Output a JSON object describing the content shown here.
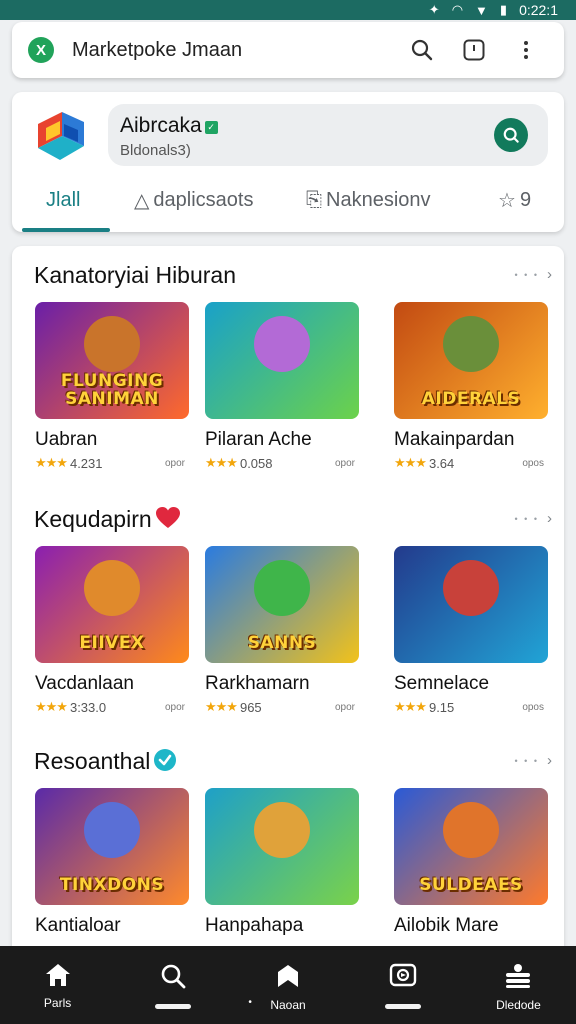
{
  "status_bar": {
    "time": "0:22:1"
  },
  "search_bar": {
    "title": "Marketpoke Jmaan",
    "badge": "X"
  },
  "app_header": {
    "name": "Aibrcaka",
    "subtitle": "Bldonals3)",
    "verified_badge": "✓",
    "tabs": [
      {
        "label": "Jlall",
        "icon": "",
        "active": true
      },
      {
        "label": "daplicsaots",
        "icon": "chart-outline-icon",
        "active": false
      },
      {
        "label": "Naknesionv",
        "icon": "bookmark-icon",
        "active": false
      },
      {
        "label": "9",
        "icon": "star-outline-icon",
        "active": false
      }
    ]
  },
  "sections": [
    {
      "title": "Kanatoryiai Hiburan",
      "title_badge": "",
      "games": [
        {
          "name": "Uabran",
          "rating": "4.231",
          "meta": "opor",
          "thumb_text": "FLUNGING SANIMAN",
          "bg": [
            "#6a1fa8",
            "#ff6a2b"
          ],
          "mascot": "#c9742b"
        },
        {
          "name": "Pilaran Ache",
          "rating": "0.058",
          "meta": "opor",
          "thumb_text": "",
          "bg": [
            "#19a1c9",
            "#6cd24a"
          ],
          "mascot": "#b36ad6"
        },
        {
          "name": "Makainpardan",
          "rating": "3.64",
          "meta": "opos",
          "thumb_text": "AIDERALS",
          "bg": [
            "#c24a12",
            "#ffb02e"
          ],
          "mascot": "#6a8f3a"
        }
      ]
    },
    {
      "title": "Kequdapirn",
      "title_badge": "heart",
      "games": [
        {
          "name": "Vacdanlaan",
          "rating": "3:33.0",
          "meta": "opor",
          "thumb_text": "EIIVEX",
          "bg": [
            "#8a1fb0",
            "#ff8a1a"
          ],
          "mascot": "#e08a2c"
        },
        {
          "name": "Rarkhamarn",
          "rating": "965",
          "meta": "opor",
          "thumb_text": "SANNS",
          "bg": [
            "#2a7be0",
            "#f2c21a"
          ],
          "mascot": "#3fb54a"
        },
        {
          "name": "Semnelace",
          "rating": "9.15",
          "meta": "opos",
          "thumb_text": "",
          "bg": [
            "#233a8c",
            "#21a4d6"
          ],
          "mascot": "#c8413a"
        }
      ]
    },
    {
      "title": "Resoanthal",
      "title_badge": "check",
      "games": [
        {
          "name": "Kantialoar",
          "rating": "",
          "meta": "",
          "thumb_text": "TINXDONS",
          "bg": [
            "#5a2aa8",
            "#ff8a2b"
          ],
          "mascot": "#5a6fd6"
        },
        {
          "name": "Hanpahapa",
          "rating": "",
          "meta": "",
          "thumb_text": "",
          "bg": [
            "#1ea0c8",
            "#7ad24a"
          ],
          "mascot": "#e0a23a"
        },
        {
          "name": "Ailobik Mare",
          "rating": "",
          "meta": "",
          "thumb_text": "SULDEAES",
          "bg": [
            "#2a5ad6",
            "#ff7a2b"
          ],
          "mascot": "#e0742b"
        }
      ]
    }
  ],
  "bottom_nav": [
    {
      "label": "Parls",
      "icon": "home-icon"
    },
    {
      "label": "",
      "icon": "search-icon"
    },
    {
      "label": "Naoan",
      "icon": "bookmark-nav-icon"
    },
    {
      "label": "",
      "icon": "games-icon"
    },
    {
      "label": "Dledode",
      "icon": "stack-icon"
    }
  ],
  "colors": {
    "accent": "#1a7f84",
    "status_bar": "#1c6b62",
    "star": "#f2a60c",
    "nav_bg": "#1b1b1b"
  }
}
